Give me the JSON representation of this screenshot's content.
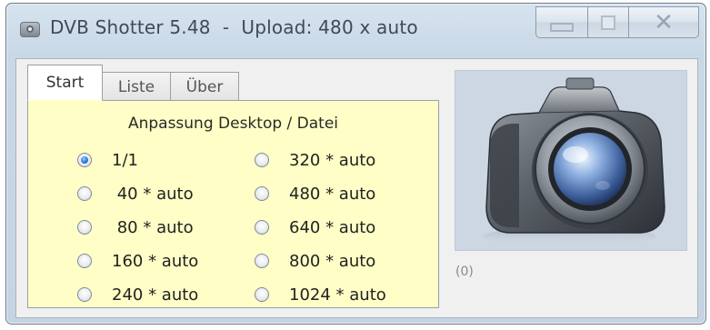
{
  "window": {
    "title": "DVB Shotter 5.48  -  Upload: 480 x auto",
    "close_glyph": "✕"
  },
  "tabs": [
    {
      "label": "Start",
      "active": true
    },
    {
      "label": "Liste",
      "active": false
    },
    {
      "label": "Über",
      "active": false
    }
  ],
  "panel": {
    "heading": "Anpassung Desktop / Datei",
    "options_left": [
      {
        "label": "1/1",
        "checked": true
      },
      {
        "label": " 40 * auto",
        "checked": false
      },
      {
        "label": " 80 * auto",
        "checked": false
      },
      {
        "label": "160 * auto",
        "checked": false
      },
      {
        "label": "240 * auto",
        "checked": false
      }
    ],
    "options_right": [
      {
        "label": "320 * auto",
        "checked": false
      },
      {
        "label": "480 * auto",
        "checked": false
      },
      {
        "label": "640 * auto",
        "checked": false
      },
      {
        "label": "800 * auto",
        "checked": false
      },
      {
        "label": "1024 * auto",
        "checked": false
      }
    ]
  },
  "preview": {
    "icon": "camera-icon"
  },
  "status": {
    "text": "(0)"
  }
}
